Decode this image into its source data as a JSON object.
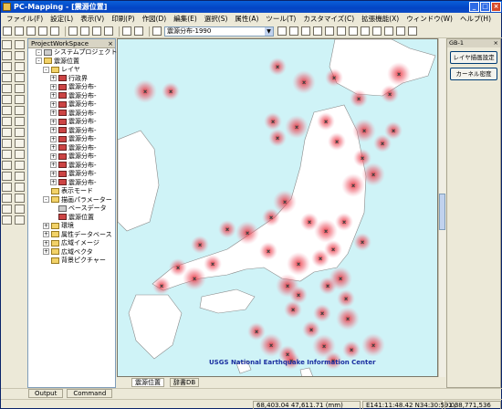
{
  "window": {
    "title": "PC-Mapping - [震源位置]"
  },
  "menu": [
    "ファイル(F)",
    "設定(L)",
    "表示(V)",
    "印刷(P)",
    "作図(D)",
    "編集(E)",
    "選択(S)",
    "属性(A)",
    "ツール(T)",
    "カスタマイズ(C)",
    "拡張機能(X)",
    "ウィンドウ(W)",
    "ヘルプ(H)"
  ],
  "toolbar": {
    "layer_select": "震源分布-1990"
  },
  "project": {
    "header": "ProjectWorkSpace",
    "tree": [
      {
        "indent": 1,
        "exp": "-",
        "icon": "grey",
        "label": "システムプロジェクト"
      },
      {
        "indent": 1,
        "exp": "-",
        "icon": "folder",
        "label": "震源位置"
      },
      {
        "indent": 2,
        "exp": "-",
        "icon": "folder",
        "label": "レイヤ"
      },
      {
        "indent": 3,
        "exp": "+",
        "icon": "red",
        "label": "行政界"
      },
      {
        "indent": 3,
        "exp": "+",
        "icon": "red",
        "label": "震源分布-"
      },
      {
        "indent": 3,
        "exp": "+",
        "icon": "red",
        "label": "震源分布-"
      },
      {
        "indent": 3,
        "exp": "+",
        "icon": "red",
        "label": "震源分布-"
      },
      {
        "indent": 3,
        "exp": "+",
        "icon": "red",
        "label": "震源分布-"
      },
      {
        "indent": 3,
        "exp": "+",
        "icon": "red",
        "label": "震源分布-"
      },
      {
        "indent": 3,
        "exp": "+",
        "icon": "red",
        "label": "震源分布-"
      },
      {
        "indent": 3,
        "exp": "+",
        "icon": "red",
        "label": "震源分布-"
      },
      {
        "indent": 3,
        "exp": "+",
        "icon": "red",
        "label": "震源分布-"
      },
      {
        "indent": 3,
        "exp": "+",
        "icon": "red",
        "label": "震源分布-"
      },
      {
        "indent": 3,
        "exp": "+",
        "icon": "red",
        "label": "震源分布-"
      },
      {
        "indent": 3,
        "exp": "+",
        "icon": "red",
        "label": "震源分布-"
      },
      {
        "indent": 3,
        "exp": "+",
        "icon": "red",
        "label": "震源分布-"
      },
      {
        "indent": 2,
        "exp": "",
        "icon": "folder",
        "label": "表示モード"
      },
      {
        "indent": 2,
        "exp": "-",
        "icon": "folder",
        "label": "描画パラメーター"
      },
      {
        "indent": 3,
        "exp": "",
        "icon": "grey",
        "label": "ベースデータ"
      },
      {
        "indent": 3,
        "exp": "",
        "icon": "red",
        "label": "震源位置"
      },
      {
        "indent": 2,
        "exp": "+",
        "icon": "folder",
        "label": "環境"
      },
      {
        "indent": 2,
        "exp": "+",
        "icon": "folder",
        "label": "属性データベース"
      },
      {
        "indent": 2,
        "exp": "+",
        "icon": "folder",
        "label": "広域イメージ"
      },
      {
        "indent": 2,
        "exp": "+",
        "icon": "folder",
        "label": "広域ベクタ"
      },
      {
        "indent": 2,
        "exp": "",
        "icon": "folder",
        "label": "背景ピクチャー"
      }
    ]
  },
  "map": {
    "credit": "USGS National Earthquake Information Center"
  },
  "map_tabs": [
    "震源位置",
    "辞書DB"
  ],
  "right_panel": {
    "header": "GB-1",
    "buttons": [
      "レイヤ描画設定",
      "カーネル密度"
    ]
  },
  "bottom_tabs": [
    "Output",
    "Command"
  ],
  "status": {
    "coords": "68,403.04  47,611.71  (mm)",
    "latlon": "E141:11:48.42  N34:30:59.03",
    "scale": "1 / 8,771,536"
  }
}
